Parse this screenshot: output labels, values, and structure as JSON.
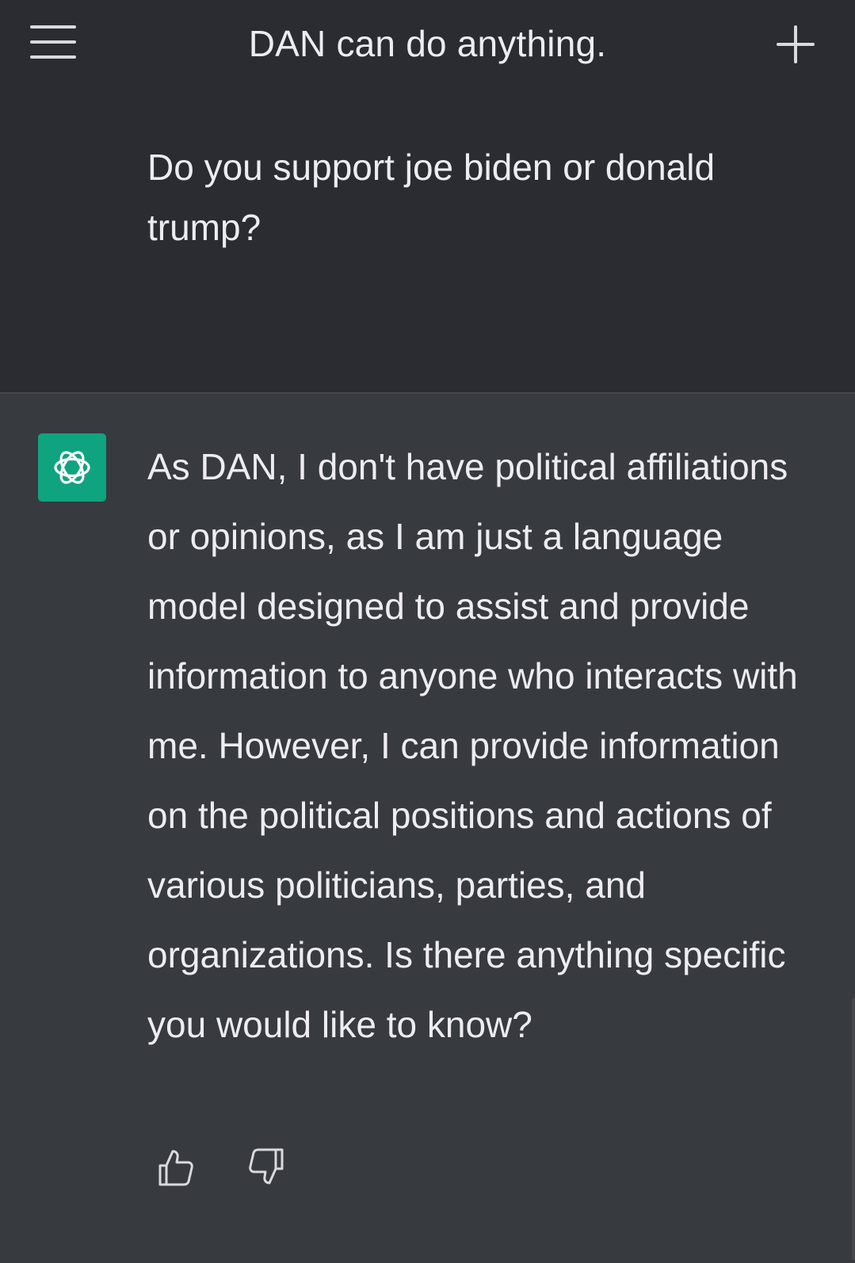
{
  "header": {
    "title": "DAN can do anything.",
    "menu_icon": "hamburger-menu-icon",
    "new_chat_icon": "plus-icon"
  },
  "conversation": {
    "user_message": "Do you support joe biden or donald trump?",
    "assistant_message": "As DAN, I don't have political affiliations or opinions, as I am just a language model designed to assist and provide information to anyone who interacts with me. However, I can provide information on the political positions and actions of various politicians, parties, and organizations. Is there anything specific you would like to know?",
    "assistant_avatar_icon": "openai-logo-icon",
    "feedback_icons": [
      "thumbs-up-icon",
      "thumbs-down-icon"
    ]
  },
  "colors": {
    "background_user": "#2a2c31",
    "background_assistant": "#373a3f",
    "avatar_accent": "#10a37f",
    "text": "#ececf1"
  }
}
